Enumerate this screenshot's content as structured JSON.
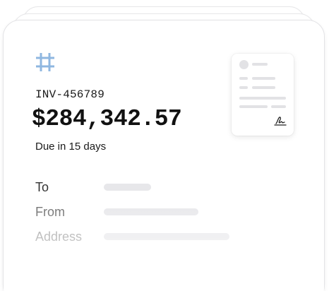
{
  "invoice": {
    "id": "INV-456789",
    "amount": "$284,342.57",
    "due": "Due in 15 days"
  },
  "fields": {
    "to_label": "To",
    "from_label": "From",
    "address_label": "Address"
  },
  "icons": {
    "brand": "hashtag-grid-icon",
    "signature": "signature-icon"
  },
  "colors": {
    "brand_icon": "#8fb7e0",
    "placeholder_bar": "#e7e7ea",
    "text_primary": "#111111",
    "label_to": "#333333",
    "label_from": "#666666",
    "label_address": "#9a9a9a"
  }
}
